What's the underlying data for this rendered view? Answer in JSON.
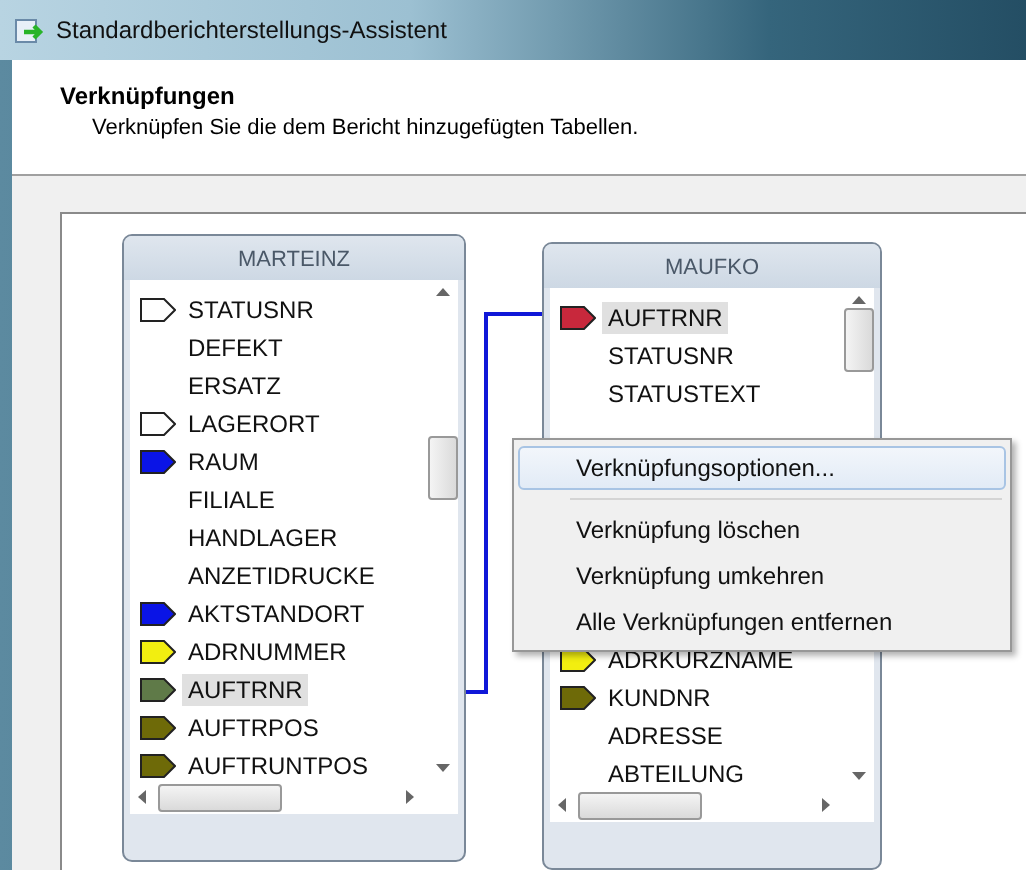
{
  "window": {
    "title": "Standardberichterstellungs-Assistent"
  },
  "header": {
    "title": "Verknüpfungen",
    "subtitle": "Verknüpfen Sie die dem Bericht hinzugefügten Tabellen."
  },
  "tables": [
    {
      "name": "MARTEINZ",
      "fields": [
        {
          "name": "STATUSNR",
          "kind": "hollow",
          "selected": false
        },
        {
          "name": "DEFEKT",
          "kind": "plain",
          "selected": false
        },
        {
          "name": "ERSATZ",
          "kind": "plain",
          "selected": false
        },
        {
          "name": "LAGERORT",
          "kind": "hollow",
          "selected": false
        },
        {
          "name": "RAUM",
          "kind": "filled",
          "color": "#0a14e6",
          "selected": false
        },
        {
          "name": "FILIALE",
          "kind": "plain",
          "selected": false
        },
        {
          "name": "HANDLAGER",
          "kind": "plain",
          "selected": false
        },
        {
          "name": "ANZETIDRUCKE",
          "kind": "plain",
          "selected": false
        },
        {
          "name": "AKTSTANDORT",
          "kind": "filled",
          "color": "#0a14e6",
          "selected": false
        },
        {
          "name": "ADRNUMMER",
          "kind": "filled",
          "color": "#f2ee10",
          "selected": false
        },
        {
          "name": "AUFTRNR",
          "kind": "filled",
          "color": "#5f7a48",
          "selected": true
        },
        {
          "name": "AUFTRPOS",
          "kind": "filled",
          "color": "#6e6a08",
          "selected": false
        },
        {
          "name": "AUFTRUNTPOS",
          "kind": "filled",
          "color": "#6e6a08",
          "selected": false
        }
      ]
    },
    {
      "name": "MAUFKO",
      "fields": [
        {
          "name": "AUFTRNR",
          "kind": "filled",
          "color": "#c8283c",
          "selected": true
        },
        {
          "name": "STATUSNR",
          "kind": "plain",
          "selected": false
        },
        {
          "name": "STATUSTEXT",
          "kind": "plain",
          "selected": false
        },
        {
          "kind": "covered"
        },
        {
          "kind": "covered"
        },
        {
          "kind": "covered"
        },
        {
          "kind": "covered"
        },
        {
          "kind": "covered"
        },
        {
          "kind": "covered"
        },
        {
          "name": "ADRKURZNAME",
          "kind": "filled",
          "color": "#f2ee10",
          "selected": false
        },
        {
          "name": "KUNDNR",
          "kind": "filled",
          "color": "#6e6a08",
          "selected": false
        },
        {
          "name": "ADRESSE",
          "kind": "plain",
          "selected": false
        },
        {
          "name": "ABTEILUNG",
          "kind": "plain",
          "selected": false
        }
      ]
    }
  ],
  "context_menu": {
    "groups": [
      [
        {
          "label": "Verknüpfungsoptionen...",
          "selected": true
        }
      ],
      [
        {
          "label": "Verknüpfung löschen",
          "selected": false
        },
        {
          "label": "Verknüpfung umkehren",
          "selected": false
        },
        {
          "label": "Alle Verknüpfungen entfernen",
          "selected": false
        }
      ]
    ]
  }
}
